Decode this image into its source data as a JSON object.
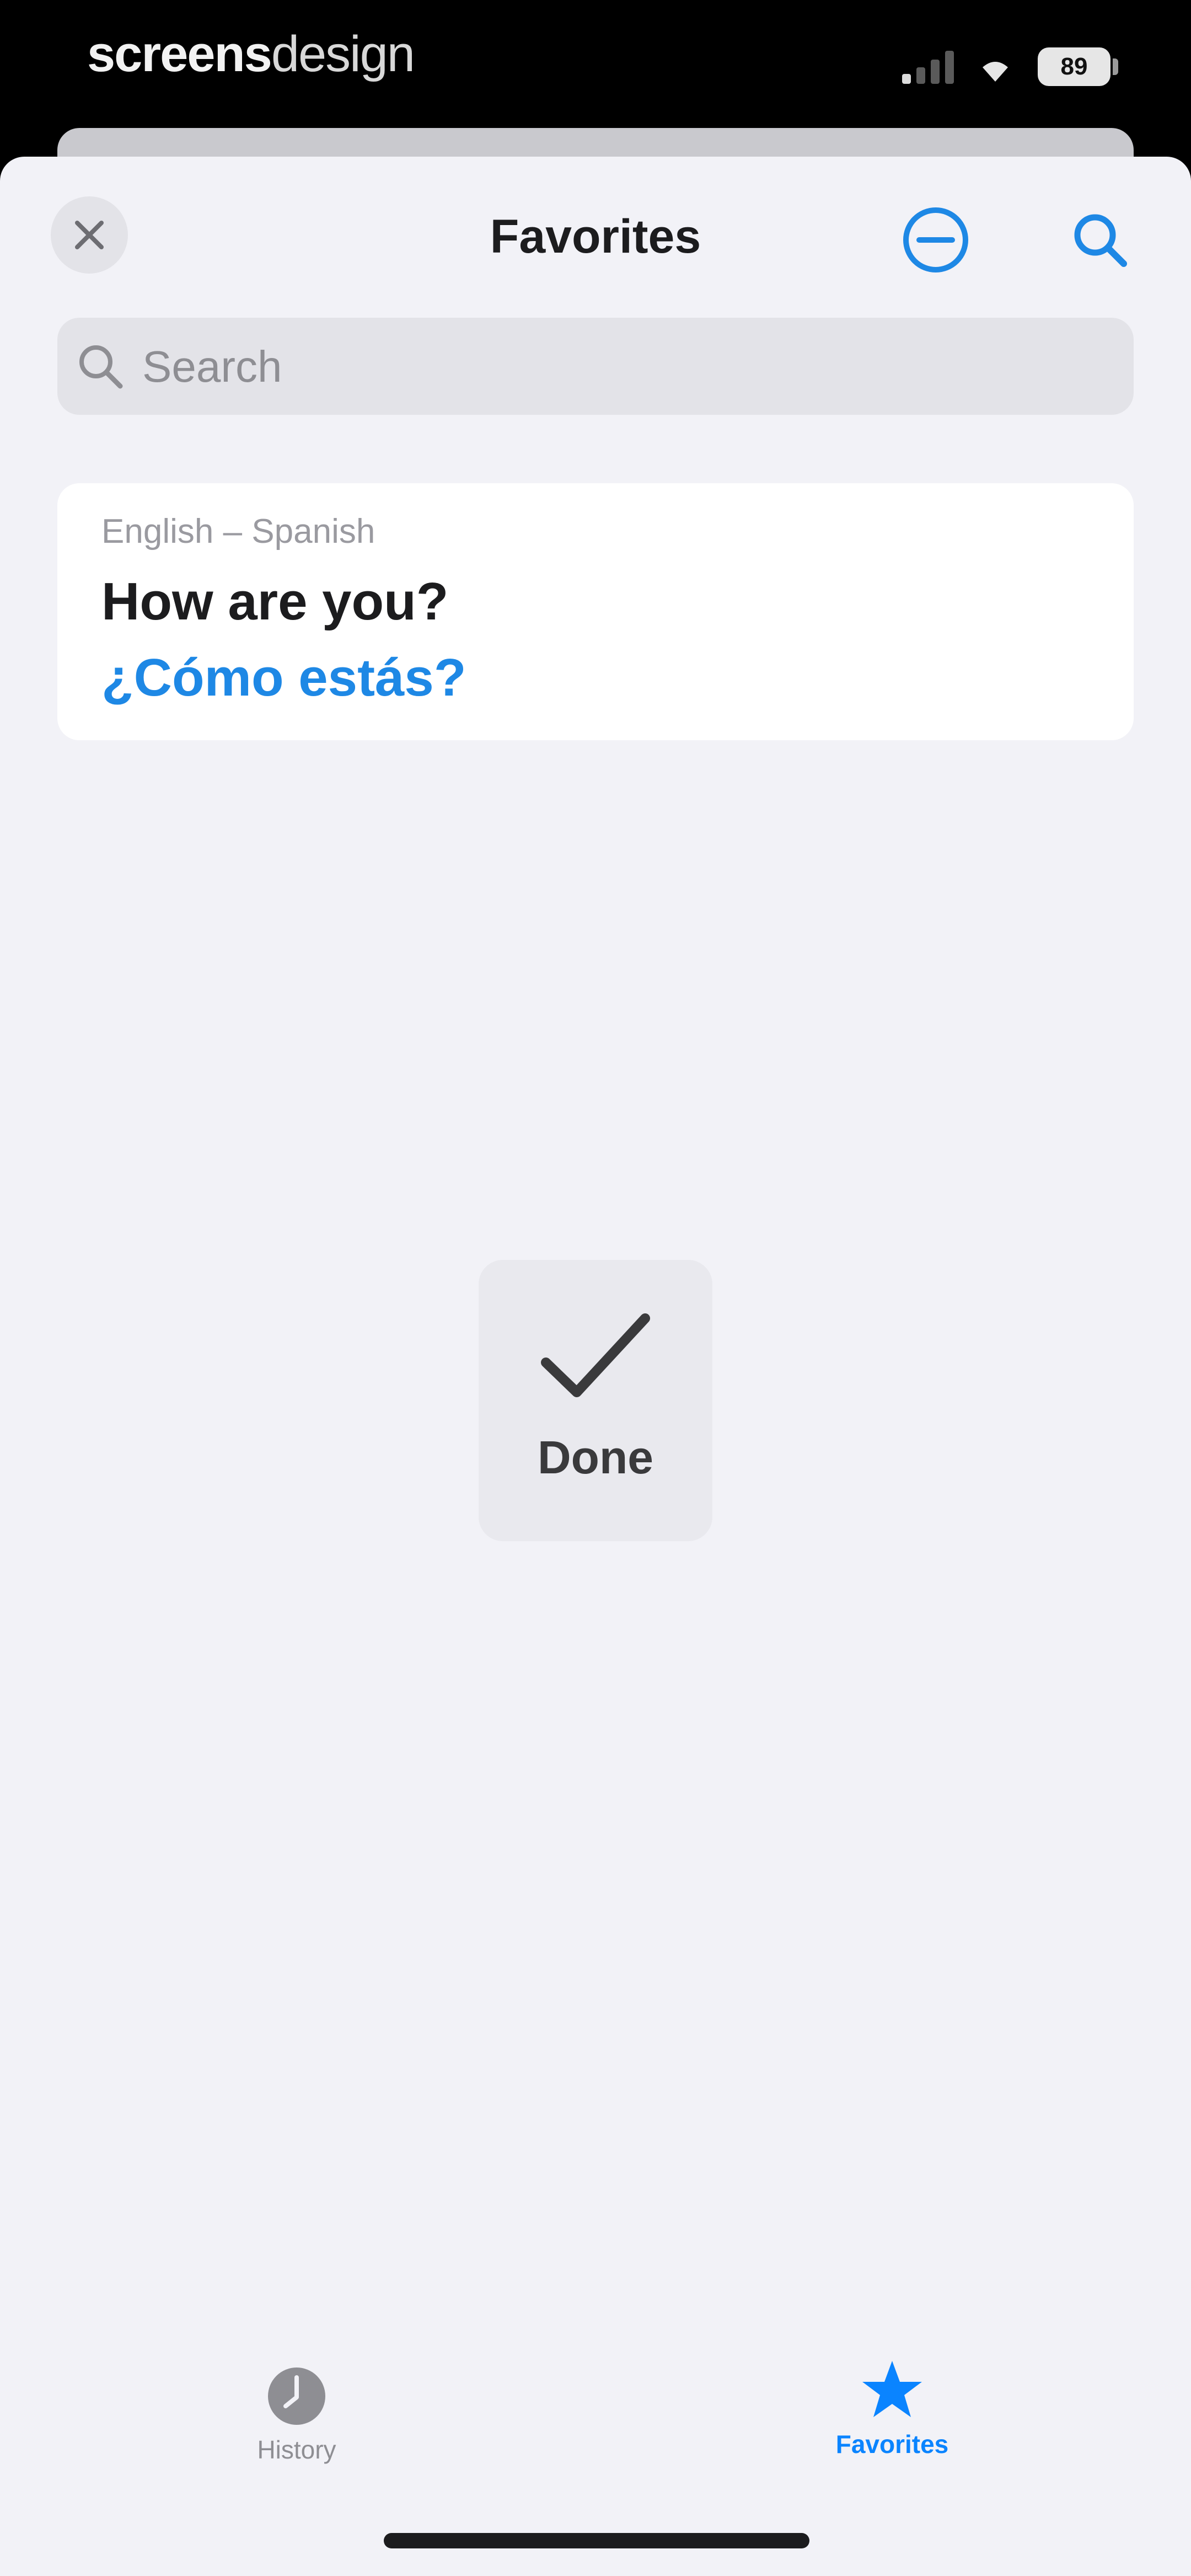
{
  "status_bar": {
    "watermark_bold": "screens",
    "watermark_light": "design",
    "battery": "89",
    "icons": [
      "cellular-signal-icon",
      "wifi-icon",
      "battery-icon"
    ]
  },
  "nav": {
    "title": "Favorites",
    "close_icon": "close-icon",
    "remove_icon": "minus-circle-icon",
    "search_icon": "search-icon"
  },
  "search": {
    "placeholder": "Search",
    "value": ""
  },
  "favorites": [
    {
      "languages": "English – Spanish",
      "source": "How are you?",
      "translation": "¿Cómo estás?"
    }
  ],
  "hud": {
    "icon": "checkmark-icon",
    "label": "Done"
  },
  "tabs": [
    {
      "label": "History",
      "icon": "clock-icon",
      "selected": false
    },
    {
      "label": "Favorites",
      "icon": "star-icon",
      "selected": true
    }
  ],
  "colors": {
    "accent": "#0a84ff",
    "translation_text": "#1e88e5",
    "sheet_background": "#f2f2f7",
    "card_background": "#ffffff"
  }
}
